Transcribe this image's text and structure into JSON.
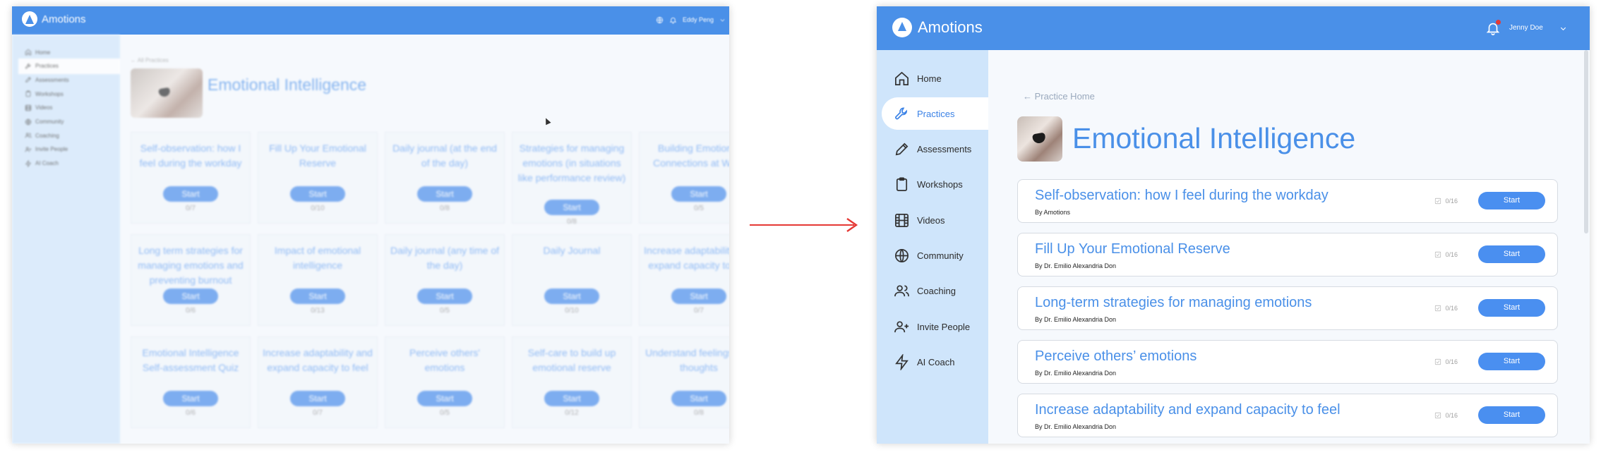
{
  "brand": {
    "name": "Amotions",
    "accent": "#4a90e8",
    "sidebar_bg": "#cfe5fb"
  },
  "left": {
    "user_name": "Eddy Peng",
    "nav": [
      {
        "label": "Home",
        "icon": "home-icon"
      },
      {
        "label": "Practices",
        "icon": "wrench-icon"
      },
      {
        "label": "Assessments",
        "icon": "pencil-icon"
      },
      {
        "label": "Workshops",
        "icon": "clipboard-icon"
      },
      {
        "label": "Videos",
        "icon": "film-icon"
      },
      {
        "label": "Community",
        "icon": "globe-icon"
      },
      {
        "label": "Coaching",
        "icon": "users-icon"
      },
      {
        "label": "Invite People",
        "icon": "user-plus-icon"
      },
      {
        "label": "AI Coach",
        "icon": "bolt-icon"
      }
    ],
    "breadcrumb": "← All Practices",
    "title": "Emotional Intelligence",
    "start_label": "Start",
    "cards": [
      {
        "title": "Self-observation: how I feel during the workday",
        "count": "0/7"
      },
      {
        "title": "Fill Up Your Emotional Reserve",
        "count": "0/10"
      },
      {
        "title": "Daily journal (at the end of the day)",
        "count": "0/8"
      },
      {
        "title": "Strategies for managing emotions (in situations like performance review)",
        "count": "0/8"
      },
      {
        "title": "Building Emotional Connections at Work",
        "count": "0/5"
      },
      {
        "title": "Long term strategies for managing emotions and preventing burnout",
        "count": "0/6"
      },
      {
        "title": "Impact of emotional intelligence",
        "count": "0/13"
      },
      {
        "title": "Daily journal (any time of the day)",
        "count": "0/5"
      },
      {
        "title": "Daily Journal",
        "count": "0/10"
      },
      {
        "title": "Increase adaptability and expand capacity to feel",
        "count": "0/7"
      },
      {
        "title": "Emotional Intelligence Self-assessment Quiz",
        "count": "0/6"
      },
      {
        "title": "Increase adaptability and expand capacity to feel",
        "count": "0/7"
      },
      {
        "title": "Perceive others' emotions",
        "count": "0/5"
      },
      {
        "title": "Self-care to build up emotional reserve",
        "count": "0/12"
      },
      {
        "title": "Understand feelings and thoughts",
        "count": "0/8"
      }
    ]
  },
  "right": {
    "user_name": "Jenny Doe",
    "nav": [
      {
        "label": "Home",
        "icon": "home-icon"
      },
      {
        "label": "Practices",
        "icon": "wrench-icon"
      },
      {
        "label": "Assessments",
        "icon": "pencil-icon"
      },
      {
        "label": "Workshops",
        "icon": "clipboard-icon"
      },
      {
        "label": "Videos",
        "icon": "film-icon"
      },
      {
        "label": "Community",
        "icon": "globe-icon"
      },
      {
        "label": "Coaching",
        "icon": "users-icon"
      },
      {
        "label": "Invite People",
        "icon": "user-plus-icon"
      },
      {
        "label": "AI Coach",
        "icon": "bolt-icon"
      }
    ],
    "breadcrumb": "← Practice Home",
    "title": "Emotional Intelligence",
    "start_label": "Start",
    "practices": [
      {
        "title": "Self-observation: how I feel during the workday",
        "author": "By Amotions",
        "count": "0/16"
      },
      {
        "title": "Fill Up Your Emotional Reserve",
        "author": "By Dr. Emilio Alexandria Don",
        "count": "0/16"
      },
      {
        "title": "Long-term strategies for managing emotions",
        "author": "By Dr. Emilio Alexandria Don",
        "count": "0/16"
      },
      {
        "title": "Perceive others’ emotions",
        "author": "By Dr. Emilio Alexandria Don",
        "count": "0/16"
      },
      {
        "title": "Increase adaptability and expand capacity to feel",
        "author": "By Dr. Emilio Alexandria Don",
        "count": "0/16"
      }
    ]
  }
}
